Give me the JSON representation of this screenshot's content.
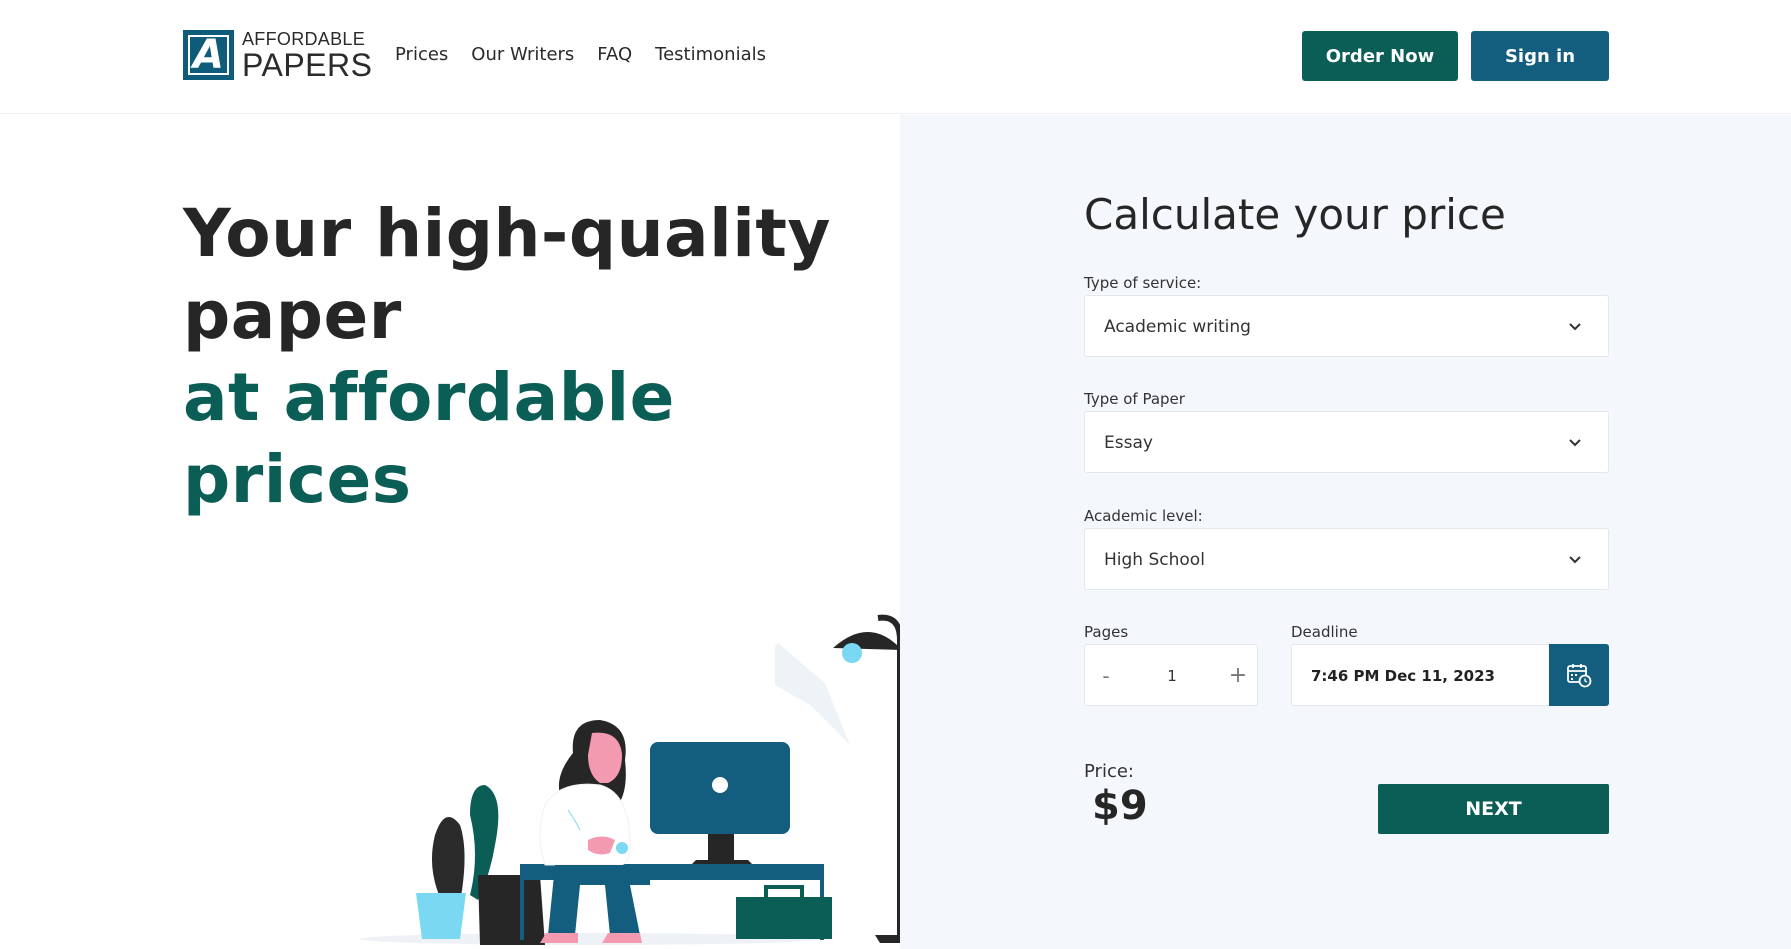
{
  "header": {
    "logo_top": "AFFORDABLE",
    "logo_bottom": "PAPERS",
    "logo_letter": "A",
    "nav": [
      "Prices",
      "Our Writers",
      "FAQ",
      "Testimonials"
    ],
    "order_now": "Order Now",
    "sign_in": "Sign in"
  },
  "hero": {
    "line1": "Your high-quality",
    "line2": "paper",
    "line3": "at affordable prices"
  },
  "calculator": {
    "title": "Calculate your price",
    "service_label": "Type of service:",
    "service_value": "Academic writing",
    "paper_label": "Type of Paper",
    "paper_value": "Essay",
    "level_label": "Academic level:",
    "level_value": "High School",
    "pages_label": "Pages",
    "pages_minus": "-",
    "pages_value": "1",
    "pages_plus": "+",
    "deadline_label": "Deadline",
    "deadline_value": "7:46 PM Dec 11, 2023",
    "price_label": "Price:",
    "price_value": "$9",
    "next_label": "NEXT"
  },
  "colors": {
    "green": "#0b5e55",
    "blue": "#135d7f",
    "panel_bg": "#f4f7fb"
  }
}
